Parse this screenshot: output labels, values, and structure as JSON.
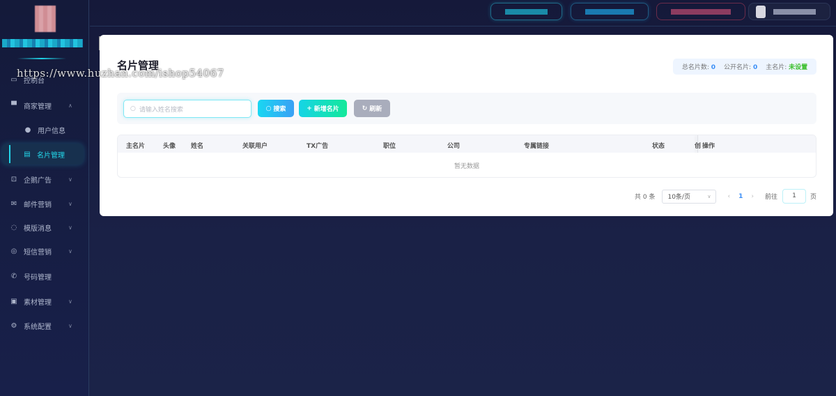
{
  "watermark": "https://www.huzhan.com/ishop54067",
  "sidebar": {
    "items": [
      {
        "label": "控制台",
        "icon": "monitor-icon"
      },
      {
        "label": "商家管理",
        "icon": "shop-icon",
        "expanded": true
      },
      {
        "label": "用户信息",
        "icon": "user-icon",
        "sub": true
      },
      {
        "label": "名片管理",
        "icon": "card-icon",
        "sub": true,
        "active": true
      },
      {
        "label": "企鹅广告",
        "icon": "billboard-icon"
      },
      {
        "label": "邮件营销",
        "icon": "mail-icon"
      },
      {
        "label": "模版消息",
        "icon": "chat-icon"
      },
      {
        "label": "短信营销",
        "icon": "sms-icon"
      },
      {
        "label": "号码管理",
        "icon": "phone-icon"
      },
      {
        "label": "素材管理",
        "icon": "image-icon"
      },
      {
        "label": "系统配置",
        "icon": "gear-icon"
      }
    ]
  },
  "page": {
    "title": "名片管理"
  },
  "stats": {
    "total_label": "总名片数:",
    "total": "0",
    "public_label": "公开名片:",
    "public": "0",
    "main_label": "主名片:",
    "main": "未设置"
  },
  "toolbar": {
    "search_placeholder": "请输入姓名搜索",
    "search": "搜索",
    "add": "新增名片",
    "refresh": "刷新"
  },
  "table": {
    "columns": [
      "主名片",
      "头像",
      "姓名",
      "关联用户",
      "TX广告",
      "职位",
      "公司",
      "专属链接",
      "状态",
      "创",
      "操作"
    ],
    "empty": "暂无数据"
  },
  "pager": {
    "total": "共 0 条",
    "size": "10条/页",
    "page": "1",
    "goto": "前往",
    "goto_value": "1",
    "unit": "页"
  },
  "colors": {
    "accent": "#23d7ea",
    "blue": "#3a8ef6",
    "green": "#3cbf2c"
  }
}
